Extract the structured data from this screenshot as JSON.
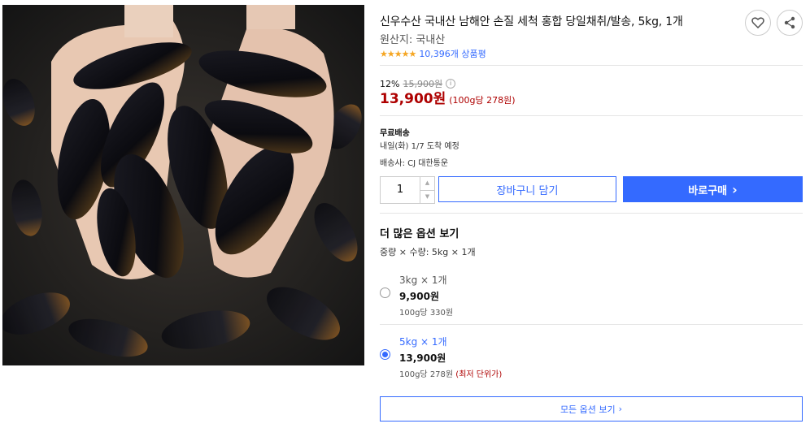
{
  "product": {
    "title": "신우수산 국내산 남해안 손질 세척 홍합 당일채취/발송, 5kg, 1개",
    "origin": "원산지: 국내산",
    "rating_stars": "★★★★★",
    "rating": 4.5,
    "review_count": "10,396개 상품평"
  },
  "price": {
    "discount_rate": "12%",
    "original_price": "15,900원",
    "info_icon": "ⓘ",
    "sale_price": "13,900원",
    "unit_price": "(100g당 278원)"
  },
  "shipping": {
    "title": "무료배송",
    "eta": "내일(화) 1/7 도착 예정",
    "carrier": "배송사: CJ 대한통운"
  },
  "purchase": {
    "quantity": "1",
    "cart_label": "장바구니 담기",
    "buy_label": "바로구매",
    "buy_arrow": "›"
  },
  "options": {
    "section_title": "더 많은 옵션 보기",
    "current": "중량 × 수량: 5kg × 1개",
    "items": [
      {
        "name": "3kg × 1개",
        "price": "9,900원",
        "unit": "100g당 330원",
        "lowest": "",
        "selected": false
      },
      {
        "name": "5kg × 1개",
        "price": "13,900원",
        "unit": "100g당 278원",
        "lowest": "(최저 단위가)",
        "selected": true
      }
    ],
    "all_options_label": "모든 옵션 보기",
    "all_options_arrow": "›"
  },
  "icons": {
    "wishlist": "heart-icon",
    "share": "share-icon"
  },
  "colors": {
    "accent": "#346aff",
    "price_red": "#ae0000",
    "star": "#f5a623"
  }
}
